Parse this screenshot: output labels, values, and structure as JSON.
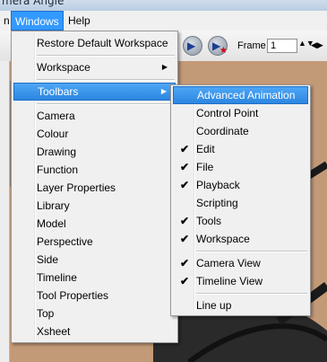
{
  "window": {
    "title": "mera Angle"
  },
  "menubar": {
    "items": [
      "n",
      "Windows",
      "Help"
    ]
  },
  "toolbar": {
    "frame_label": "Frame",
    "frame_value": "1"
  },
  "windows_menu": {
    "items": [
      "Restore Default Workspace",
      "Workspace",
      "Toolbars",
      "Camera",
      "Colour",
      "Drawing",
      "Function",
      "Layer Properties",
      "Library",
      "Model",
      "Perspective",
      "Side",
      "Timeline",
      "Tool Properties",
      "Top",
      "Xsheet"
    ]
  },
  "toolbars_submenu": {
    "items": [
      "Advanced Animation",
      "Control Point",
      "Coordinate",
      "Edit",
      "File",
      "Playback",
      "Scripting",
      "Tools",
      "Workspace",
      "Camera View",
      "Timeline View",
      "Line up"
    ],
    "checked": [
      false,
      false,
      false,
      true,
      true,
      true,
      false,
      true,
      true,
      true,
      true,
      false
    ]
  },
  "colors": {
    "highlight": "#3399ff",
    "menu_bg": "#f0f0f0",
    "canvas": "#c39a78"
  },
  "icons": {
    "check": "✔",
    "submenu_arrow": "▶",
    "spin": "▲▼",
    "nav_arrows": "◀▶"
  }
}
